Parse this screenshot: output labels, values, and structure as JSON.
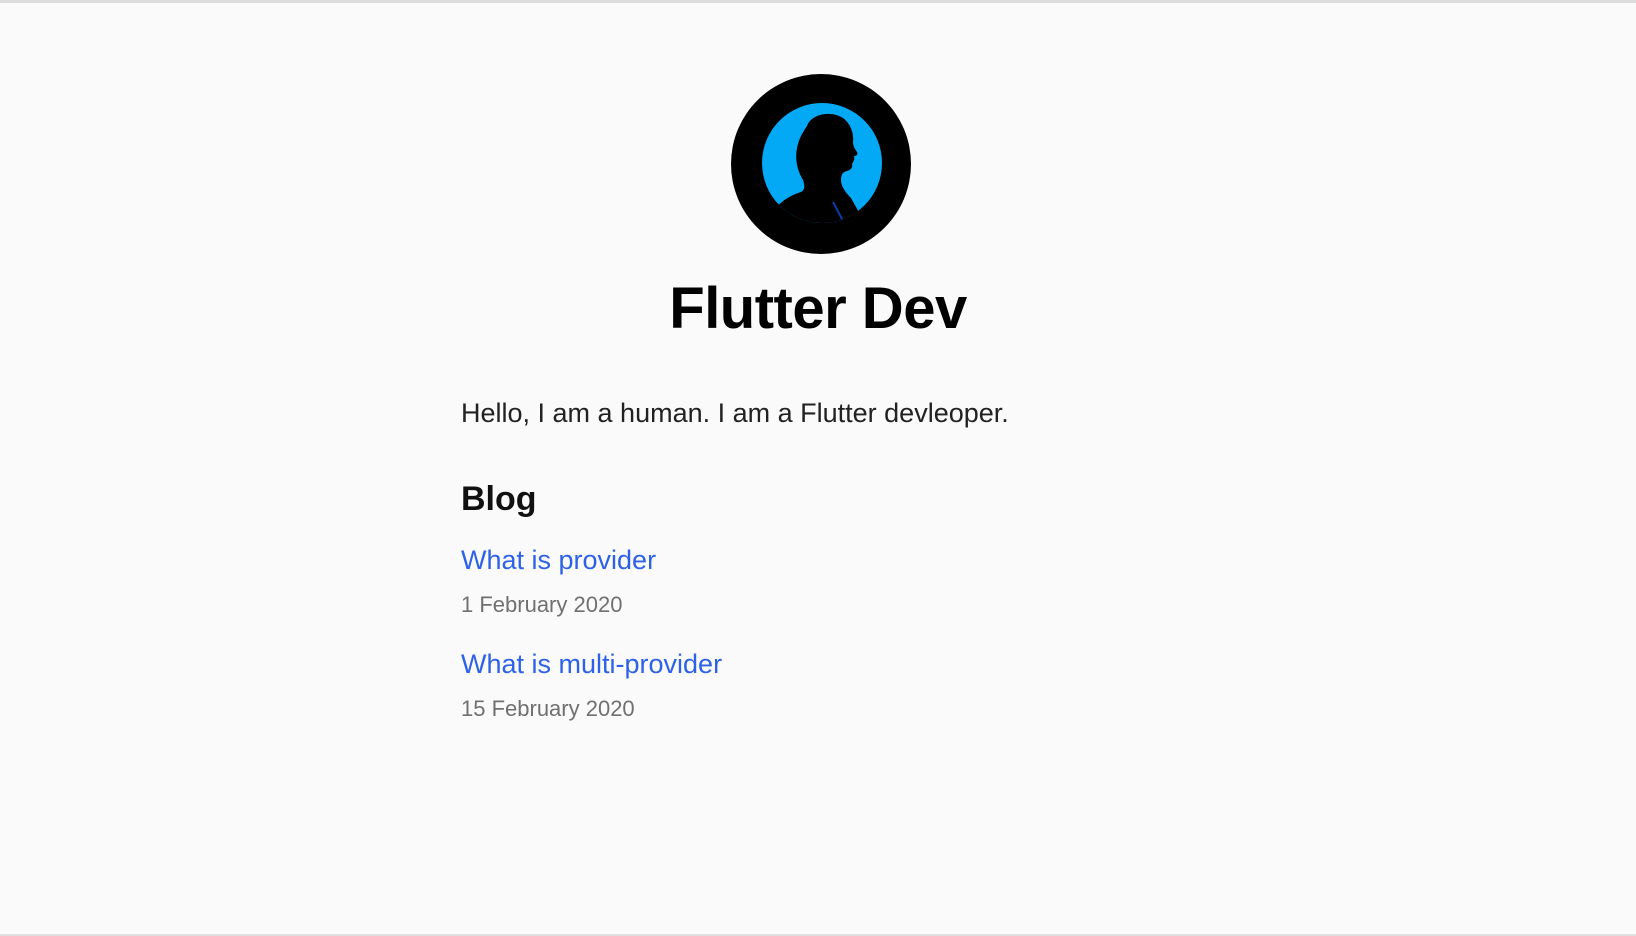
{
  "profile": {
    "avatar_icon": "person-silhouette-icon",
    "name": "Flutter Dev",
    "bio": "Hello, I am a human. I am a Flutter devleoper."
  },
  "blog": {
    "heading": "Blog",
    "posts": [
      {
        "title": "What is provider",
        "date": "1 February 2020"
      },
      {
        "title": "What is multi-provider",
        "date": "15 February 2020"
      }
    ]
  },
  "colors": {
    "background": "#fafafa",
    "link": "#2d62e6",
    "avatar_ring": "#000000",
    "avatar_inner": "#03a9f4",
    "date_text": "#707070"
  }
}
